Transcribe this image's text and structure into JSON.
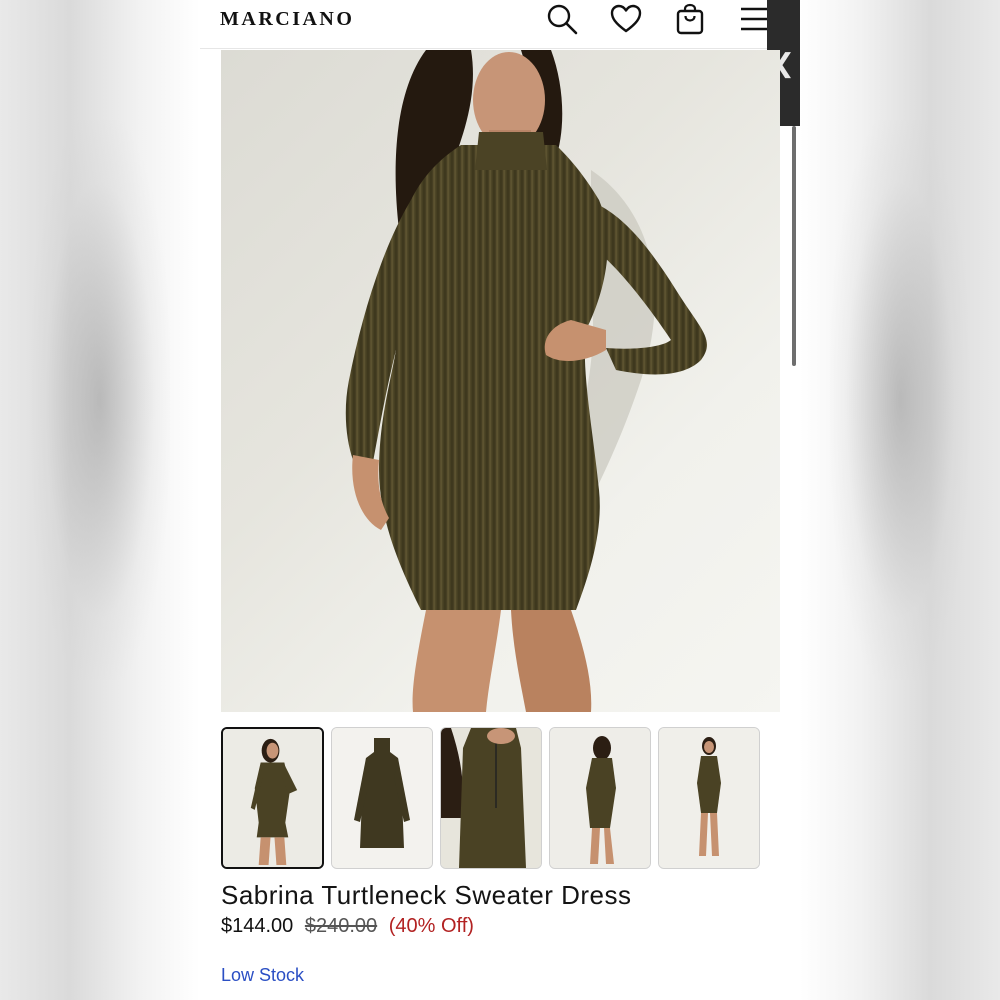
{
  "header": {
    "logo": "MARCIANO",
    "icons": [
      "search-icon",
      "heart-icon",
      "bag-icon",
      "menu-icon"
    ]
  },
  "drawer": {
    "handle_glyph": "❮"
  },
  "product": {
    "title": "Sabrina Turtleneck Sweater Dress",
    "price": "$144.00",
    "original_price": "$240.00",
    "discount": "(40% Off)",
    "stock_status": "Low Stock",
    "thumbnail_count": 5,
    "selected_thumbnail": 1
  },
  "colors": {
    "dress": "#4a4224",
    "price_discount": "#b22222",
    "stock": "#2b4fc4"
  }
}
